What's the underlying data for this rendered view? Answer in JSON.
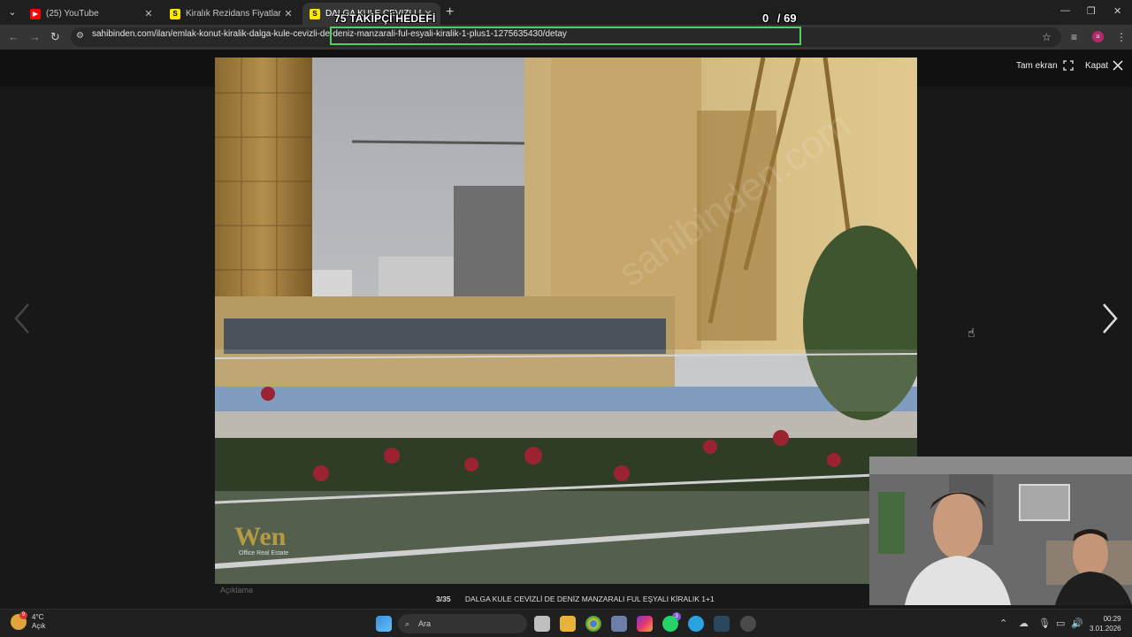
{
  "browser": {
    "tabs": [
      {
        "title": "(25) YouTube",
        "favicon": "youtube-icon",
        "color": "#ff0000"
      },
      {
        "title": "Kiralık Rezidans Fiyatları sahibinden",
        "favicon": "sahibinden-icon",
        "color": "#ffe800"
      },
      {
        "title": "DALGA KULE CEVİZLİ DE DENİZ",
        "favicon": "sahibinden-icon",
        "color": "#ffe800"
      }
    ],
    "url": "sahibinden.com/ilan/emlak-konut-kiralik-dalga-kule-cevizli-de-deniz-manzarali-ful-esyali-kiralik-1-plus1-1275635430/detay",
    "avatar_letter": "u"
  },
  "overlay": {
    "goal_text": "75 TAKİPÇİ HEDEFİ",
    "current": "0",
    "separator": "/ 69"
  },
  "gallery": {
    "fullscreen_label": "Tam ekran",
    "close_label": "Kapat",
    "page": "3/35",
    "caption": "DALGA KULE CEVİZLİ DE DENİZ MANZARALI FUL EŞYALI KİRALIK 1+1",
    "description_label": "Açıklama",
    "watermark_brand": "Wen",
    "watermark_sub": "Office Real Estate",
    "watermark_site": "sahibinden.com"
  },
  "taskbar": {
    "weather_temp": "4°C",
    "weather_desc": "Açık",
    "search_placeholder": "Ara",
    "time": "00:29",
    "date": "3.01.2026",
    "instagram_badge": "3",
    "weather_badge": "9"
  }
}
